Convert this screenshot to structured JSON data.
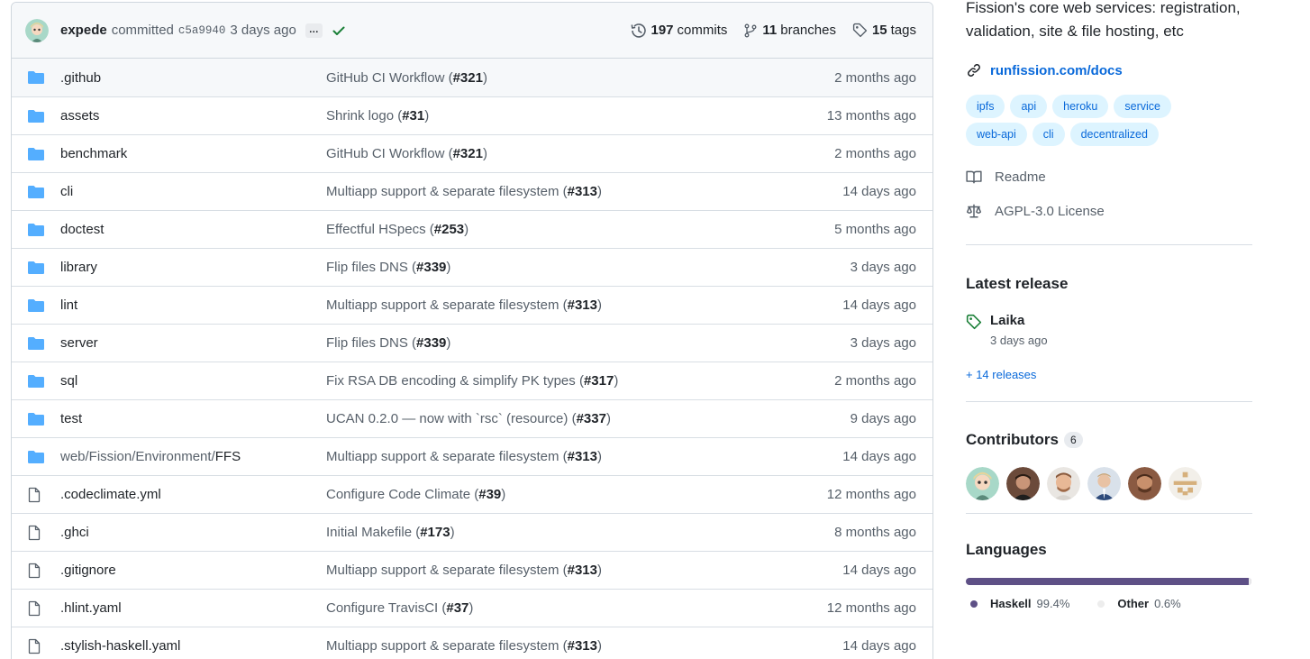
{
  "commit": {
    "author": "expede",
    "action": "committed",
    "sha": "c5a9940",
    "time": "3 days ago",
    "ellipsis": "…",
    "commits_count": "197",
    "commits_label": "commits",
    "branches_count": "11",
    "branches_label": "branches",
    "tags_count": "15",
    "tags_label": "tags"
  },
  "files": [
    {
      "type": "dir",
      "name": ".github",
      "msg": "GitHub CI Workflow (",
      "pr": "#321",
      "tail": ")",
      "age": "2 months ago"
    },
    {
      "type": "dir",
      "name": "assets",
      "msg": "Shrink logo (",
      "pr": "#31",
      "tail": ")",
      "age": "13 months ago"
    },
    {
      "type": "dir",
      "name": "benchmark",
      "msg": "GitHub CI Workflow (",
      "pr": "#321",
      "tail": ")",
      "age": "2 months ago"
    },
    {
      "type": "dir",
      "name": "cli",
      "msg": "Multiapp support & separate filesystem (",
      "pr": "#313",
      "tail": ")",
      "age": "14 days ago"
    },
    {
      "type": "dir",
      "name": "doctest",
      "msg": "Effectful HSpecs (",
      "pr": "#253",
      "tail": ")",
      "age": "5 months ago"
    },
    {
      "type": "dir",
      "name": "library",
      "msg": "Flip files DNS (",
      "pr": "#339",
      "tail": ")",
      "age": "3 days ago"
    },
    {
      "type": "dir",
      "name": "lint",
      "msg": "Multiapp support & separate filesystem (",
      "pr": "#313",
      "tail": ")",
      "age": "14 days ago"
    },
    {
      "type": "dir",
      "name": "server",
      "msg": "Flip files DNS (",
      "pr": "#339",
      "tail": ")",
      "age": "3 days ago"
    },
    {
      "type": "dir",
      "name": "sql",
      "msg": "Fix RSA DB encoding & simplify PK types (",
      "pr": "#317",
      "tail": ")",
      "age": "2 months ago"
    },
    {
      "type": "dir",
      "name": "test",
      "msg": "UCAN 0.2.0 — now with `rsc` (resource) (",
      "pr": "#337",
      "tail": ")",
      "age": "9 days ago"
    },
    {
      "type": "dir",
      "name_dim": "web/Fission/Environment/",
      "name": "FFS",
      "msg": "Multiapp support & separate filesystem (",
      "pr": "#313",
      "tail": ")",
      "age": "14 days ago"
    },
    {
      "type": "file",
      "name": ".codeclimate.yml",
      "msg": "Configure Code Climate (",
      "pr": "#39",
      "tail": ")",
      "age": "12 months ago"
    },
    {
      "type": "file",
      "name": ".ghci",
      "msg": "Initial Makefile (",
      "pr": "#173",
      "tail": ")",
      "age": "8 months ago"
    },
    {
      "type": "file",
      "name": ".gitignore",
      "msg": "Multiapp support & separate filesystem (",
      "pr": "#313",
      "tail": ")",
      "age": "14 days ago"
    },
    {
      "type": "file",
      "name": ".hlint.yaml",
      "msg": "Configure TravisCI (",
      "pr": "#37",
      "tail": ")",
      "age": "12 months ago"
    },
    {
      "type": "file",
      "name": ".stylish-haskell.yaml",
      "msg": "Multiapp support & separate filesystem (",
      "pr": "#313",
      "tail": ")",
      "age": "14 days ago"
    }
  ],
  "sidebar": {
    "about": "Fission's core web services: registration, validation, site & file hosting, etc",
    "website": "runfission.com/docs",
    "topics": [
      "ipfs",
      "api",
      "heroku",
      "service",
      "web-api",
      "cli",
      "decentralized"
    ],
    "readme": "Readme",
    "license": "AGPL-3.0 License",
    "latest_release_heading": "Latest release",
    "release_name": "Laika",
    "release_date": "3 days ago",
    "more_releases": "+ 14 releases",
    "contributors_heading": "Contributors",
    "contributors_count": "6",
    "languages_heading": "Languages",
    "languages": [
      {
        "name": "Haskell",
        "pct": "99.4%",
        "color": "#5e5086",
        "value": 99.4
      },
      {
        "name": "Other",
        "pct": "0.6%",
        "color": "#ededed",
        "value": 0.6
      }
    ]
  }
}
